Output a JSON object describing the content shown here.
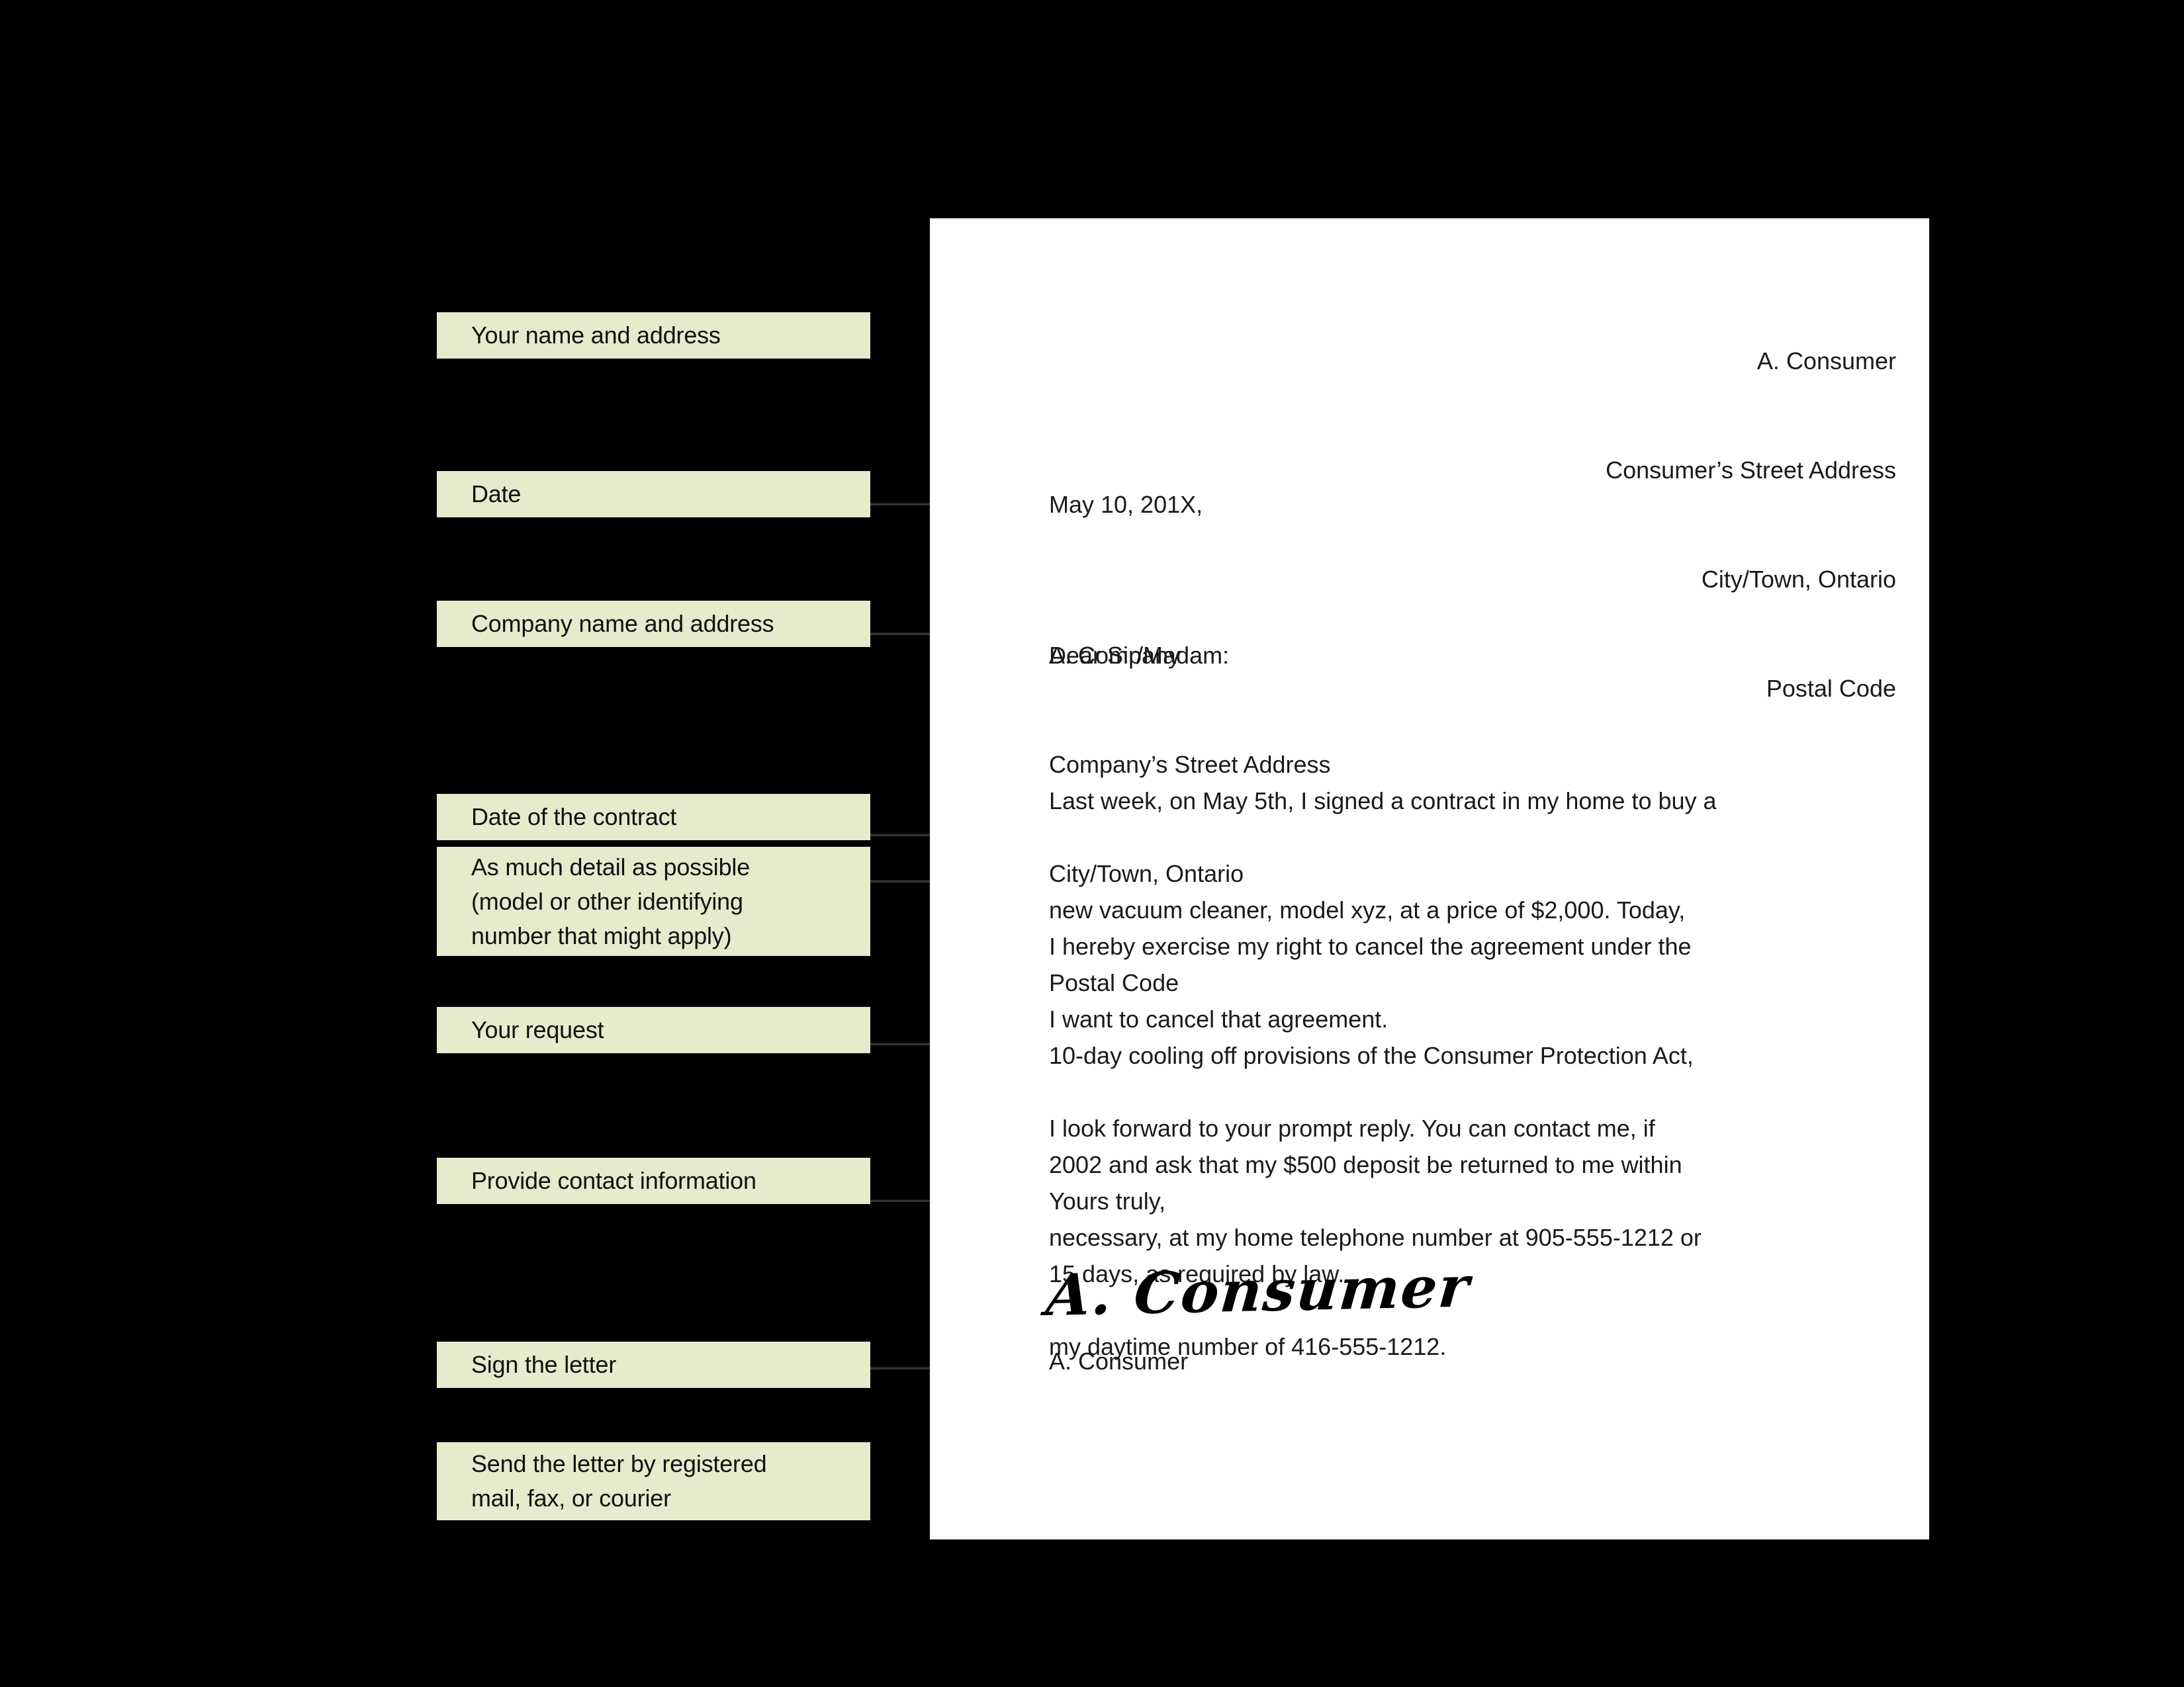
{
  "theme": {
    "background": "#000000",
    "label_fill": "#e5ebcd",
    "page_fill": "#ffffff",
    "ink": "#1a1a1a",
    "line": "#333333"
  },
  "callouts": [
    {
      "id": "your-name-and-address",
      "lines": [
        "Your name and address"
      ]
    },
    {
      "id": "date",
      "lines": [
        "Date"
      ]
    },
    {
      "id": "company-name-and-address",
      "lines": [
        "Company name and address"
      ]
    },
    {
      "id": "date-of-the-contract",
      "lines": [
        "Date of the contract"
      ]
    },
    {
      "id": "as-much-detail-as-possible",
      "lines": [
        "As much detail as possible",
        "(model or other identifying",
        "number that might apply)"
      ]
    },
    {
      "id": "your-request",
      "lines": [
        "Your request"
      ]
    },
    {
      "id": "provide-contact-information",
      "lines": [
        "Provide contact information"
      ]
    },
    {
      "id": "sign-the-letter",
      "lines": [
        "Sign the letter"
      ]
    },
    {
      "id": "send-the-letter",
      "lines": [
        "Send the letter by registered",
        "mail, fax, or courier"
      ]
    }
  ],
  "letter": {
    "sender_address": [
      "A. Consumer",
      "Consumer’s Street Address",
      "City/Town, Ontario",
      "Postal Code"
    ],
    "date_line": "May 10, 201X,",
    "recipient_address": [
      "A. Company",
      "Company’s Street Address",
      "City/Town, Ontario",
      "Postal Code"
    ],
    "salutation": "Dear Sir/Madam:",
    "body_paragraph_1": [
      "Last week, on May 5th, I signed a contract in my home to buy a",
      "new vacuum cleaner, model xyz, at a price of $2,000. Today,",
      "I want to cancel that agreement."
    ],
    "body_paragraph_2": [
      "I hereby exercise my right to cancel the agreement under the",
      "10-day cooling off provisions of the Consumer Protection Act,",
      "2002 and ask that my $500 deposit be returned to me within",
      "15 days, as required by law."
    ],
    "body_paragraph_3": [
      "I look forward to your prompt reply. You can contact me, if",
      "necessary, at my home telephone number at 905-555-1212 or",
      "my daytime number of 416-555-1212."
    ],
    "closing": "Yours truly,",
    "signature_script": "A. Consumer",
    "signature_printed": "A. Consumer"
  }
}
